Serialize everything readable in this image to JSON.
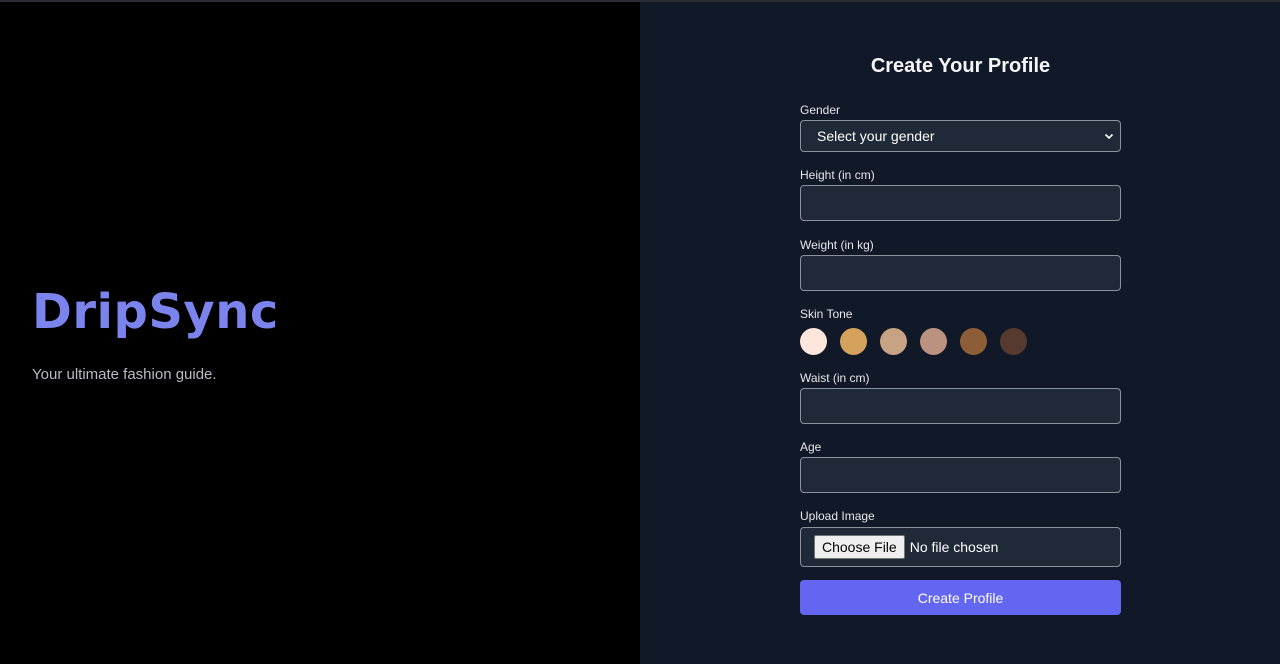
{
  "brand": {
    "name": "DripSync",
    "tagline": "Your ultimate fashion guide."
  },
  "form": {
    "title": "Create Your Profile",
    "gender": {
      "label": "Gender",
      "selected": "Select your gender"
    },
    "height": {
      "label": "Height (in cm)",
      "value": ""
    },
    "weight": {
      "label": "Weight (in kg)",
      "value": ""
    },
    "skin_tone": {
      "label": "Skin Tone",
      "swatches": [
        "#fde6dc",
        "#d4a25c",
        "#c8a383",
        "#bb9180",
        "#8c5d36",
        "#573a2f"
      ]
    },
    "waist": {
      "label": "Waist (in cm)",
      "value": ""
    },
    "age": {
      "label": "Age",
      "value": ""
    },
    "upload": {
      "label": "Upload Image",
      "button_label": "Choose File",
      "status": "No file chosen"
    },
    "submit_label": "Create Profile"
  },
  "colors": {
    "brand_accent": "#7b84ec",
    "button_primary": "#6366f1",
    "panel_bg": "#111827",
    "field_bg": "#1f2937"
  }
}
